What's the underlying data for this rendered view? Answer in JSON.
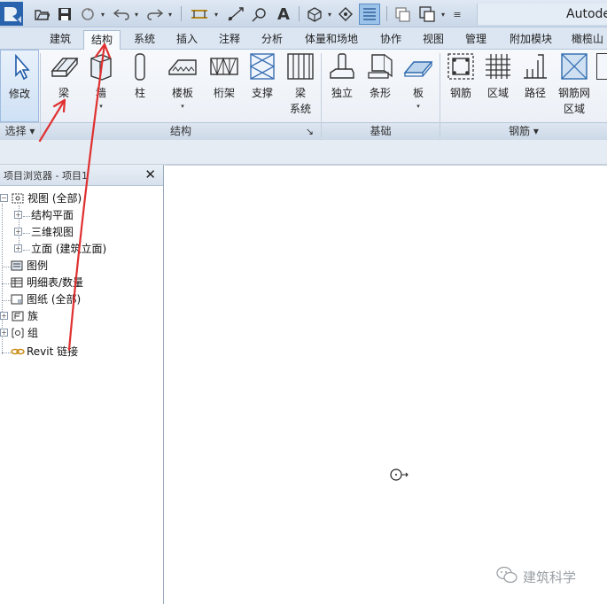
{
  "app": {
    "title": "Autodesk"
  },
  "quick_access": {
    "icons": [
      "revit-logo-icon",
      "open-icon",
      "save-icon",
      "sync-icon",
      "undo-icon",
      "redo-icon",
      "measure-icon",
      "dimension-icon",
      "tag-icon",
      "text-icon",
      "3d-view-icon",
      "section-icon",
      "thin-lines-icon",
      "close-hidden-icon",
      "switch-windows-icon",
      "customize-icon"
    ],
    "text_tool": "A"
  },
  "tabs": [
    {
      "label": "建筑"
    },
    {
      "label": "结构",
      "active": true
    },
    {
      "label": "系统"
    },
    {
      "label": "插入"
    },
    {
      "label": "注释"
    },
    {
      "label": "分析"
    },
    {
      "label": "体量和场地"
    },
    {
      "label": "协作"
    },
    {
      "label": "视图"
    },
    {
      "label": "管理"
    },
    {
      "label": "附加模块"
    },
    {
      "label": "橄榄山"
    }
  ],
  "ribbon": {
    "tools": [
      {
        "label": "修改",
        "icon": "cursor-arrow-icon"
      },
      {
        "label": "梁",
        "icon": "beam-icon"
      },
      {
        "label": "墙",
        "icon": "wall-icon",
        "dropdown": "▾"
      },
      {
        "label": "柱",
        "icon": "column-icon"
      },
      {
        "label": "楼板",
        "icon": "floor-slab-icon",
        "dropdown": "▾"
      },
      {
        "label": "桁架",
        "icon": "truss-icon"
      },
      {
        "label": "支撑",
        "icon": "brace-icon"
      },
      {
        "label": "梁",
        "label2": "系统",
        "icon": "beam-system-icon"
      },
      {
        "label": "独立",
        "icon": "isolated-foundation-icon"
      },
      {
        "label": "条形",
        "icon": "strip-foundation-icon"
      },
      {
        "label": "板",
        "icon": "foundation-slab-icon",
        "dropdown": "▾"
      },
      {
        "label": "钢筋",
        "icon": "rebar-icon"
      },
      {
        "label": "区域",
        "icon": "area-rebar-icon"
      },
      {
        "label": "路径",
        "icon": "path-rebar-icon"
      },
      {
        "label": "钢筋网",
        "label2": "区域",
        "icon": "fabric-area-icon"
      }
    ],
    "panels": [
      {
        "label": "选择 ▾"
      },
      {
        "label": "结构",
        "launcher": "↘"
      },
      {
        "label": "基础"
      },
      {
        "label": "钢筋 ▾"
      }
    ]
  },
  "project_browser": {
    "title": "项目浏览器 - 项目1",
    "close": "✕",
    "tree": [
      {
        "label": "视图 (全部)",
        "toggle": "−",
        "icon": "view-icon"
      },
      {
        "label": "结构平面",
        "toggle": "+"
      },
      {
        "label": "三维视图",
        "toggle": "+"
      },
      {
        "label": "立面 (建筑立面)",
        "toggle": "+"
      },
      {
        "label": "图例",
        "icon": "legend-icon"
      },
      {
        "label": "明细表/数量",
        "icon": "schedule-icon"
      },
      {
        "label": "图纸 (全部)",
        "icon": "sheet-icon"
      },
      {
        "label": "族",
        "toggle": "+",
        "icon": "family-icon"
      },
      {
        "label": "组",
        "toggle": "+",
        "icon": "group-icon"
      },
      {
        "label": "Revit 链接",
        "icon": "link-icon"
      }
    ]
  },
  "canvas": {
    "cursor": "rotate-cursor-icon"
  },
  "watermark": {
    "text": "建筑科学",
    "icon": "wechat-icon"
  },
  "colors": {
    "accent": "#1e5aa8",
    "annotation_arrow": "#e03030",
    "ribbon_bg": "#eef2f7"
  }
}
